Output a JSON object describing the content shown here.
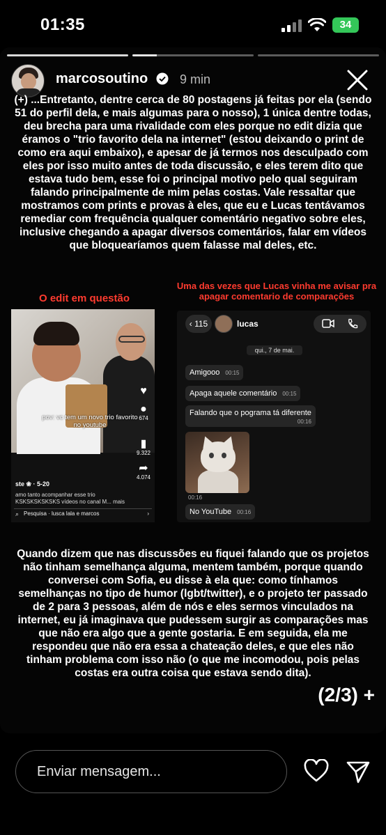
{
  "status_bar": {
    "time": "01:35",
    "battery": "34"
  },
  "story": {
    "username": "marcosoutino",
    "posted": "9 min",
    "paragraph1": "(+) ...Entretanto, dentre cerca de 80 postagens já feitas por ela (sendo 51 do perfil dela, e mais algumas para o nosso), 1 única dentre todas, deu brecha para uma rivalidade com eles porque no edit dizia que éramos o \"trio favorito dela na internet\" (estou deixando o print de como era aqui embaixo), e apesar de já termos nos desculpado com eles por isso muito antes de toda discussão, e eles terem dito que estava tudo bem, esse foi o principal motivo pelo qual seguiram falando principalmente de mim pelas costas. Vale ressaltar que mostramos com prints e provas à eles, que eu e Lucas tentávamos remediar com frequência qualquer comentário negativo sobre eles, inclusive chegando a apagar diversos comentários, falar em vídeos que bloquearíamos quem falasse mal deles, etc.",
    "caption_left": "O edit em questão",
    "caption_right": "Uma das vezes que Lucas vinha me avisar pra apagar comentario de comparações",
    "paragraph2": "Quando dizem que nas discussões eu fiquei falando que os projetos não tinham semelhança alguma, mentem também, porque quando conversei com Sofia, eu disse à ela que: como tínhamos semelhanças no tipo de humor (lgbt/twitter), e o projeto ter passado de 2 para 3 pessoas, além de nós e eles sermos vinculados na internet, eu já imaginava que pudessem surgir as comparações mas que não era algo que a gente gostaria. E em seguida, ela me respondeu que não era essa a chateação deles, e que eles não tinham problema com isso não (o que me incomodou, pois pelas costas era outra coisa que estava sendo dita).",
    "page_count": "(2/3) +"
  },
  "edit_shot": {
    "overlay": "pov: vc tem um novo trio favorito no youtube",
    "counts": [
      "674",
      "9.322",
      "4.074"
    ],
    "user": "ste ❀ · 5-20",
    "desc": "amo tanto acompanhar esse trio KSKSKSKSKSKS vídeos no canal M... mais",
    "search": "Pesquisa · lusca lala e marcos"
  },
  "chat_shot": {
    "back_count": "115",
    "contact": "lucas",
    "date": "qui., 7 de mai.",
    "messages": [
      {
        "text": "Amigooo",
        "time": "00:15"
      },
      {
        "text": "Apaga aquele comentário",
        "time": "00:15"
      },
      {
        "text": "Falando que o pograma tá diferente",
        "time": "00:16"
      }
    ],
    "image_time": "00:16",
    "last_message": {
      "text": "No YouTube",
      "time": "00:16"
    }
  },
  "composer": {
    "placeholder": "Enviar mensagem..."
  }
}
